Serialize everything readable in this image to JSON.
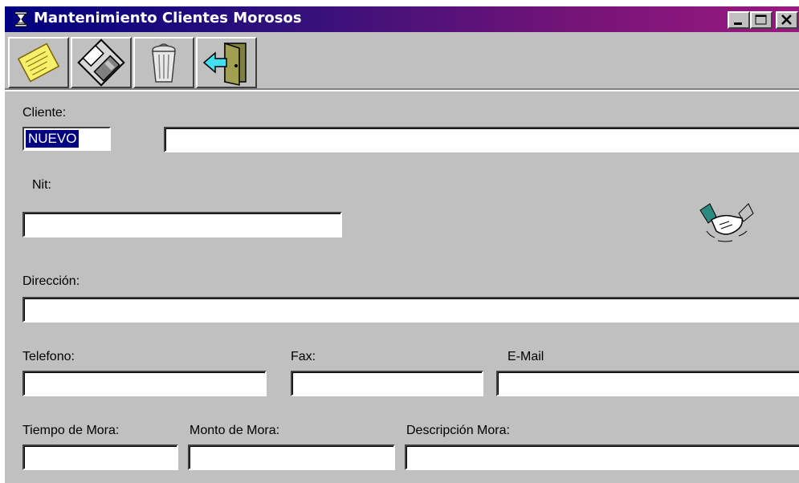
{
  "window": {
    "title": "Mantenimiento Clientes Morosos"
  },
  "titlebar_buttons": [
    {
      "name": "minimize",
      "glyph": "_"
    },
    {
      "name": "maximize",
      "glyph": "□"
    },
    {
      "name": "close",
      "glyph": "×"
    }
  ],
  "toolbar": [
    {
      "name": "notes",
      "icon": "sticky-note-icon"
    },
    {
      "name": "save",
      "icon": "floppy-disk-icon"
    },
    {
      "name": "delete",
      "icon": "trash-can-icon"
    },
    {
      "name": "exit",
      "icon": "exit-door-icon"
    }
  ],
  "form": {
    "cliente_label": "Cliente:",
    "cliente_code": "NUEVO",
    "cliente_name": "",
    "nit_label": "Nit:",
    "nit": "",
    "direccion_label": "Dirección:",
    "direccion": "",
    "telefono_label": "Telefono:",
    "telefono": "",
    "fax_label": "Fax:",
    "fax": "",
    "email_label": "E-Mail",
    "email": "",
    "tiempo_mora_label": "Tiempo de Mora:",
    "tiempo_mora": "",
    "monto_mora_label": "Monto de Mora:",
    "monto_mora": "",
    "descripcion_mora_label": "Descripción Mora:",
    "descripcion_mora": ""
  },
  "decor": {
    "icon": "handshake-icon"
  }
}
